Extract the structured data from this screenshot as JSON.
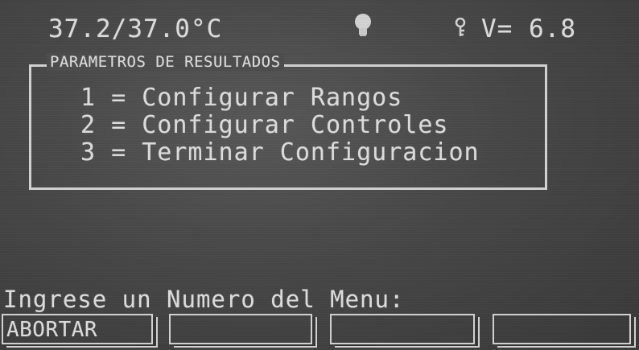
{
  "status_bar": {
    "temperature": "37.2/37.0°C",
    "bulb_icon": "lamp-icon",
    "key_icon": "key-icon",
    "voltage": "V= 6.8"
  },
  "menu": {
    "title": "PARAMETROS DE RESULTADOS",
    "items": [
      "1 = Configurar Rangos",
      "2 = Configurar Controles",
      "3 = Terminar Configuracion"
    ]
  },
  "prompt": "Ingrese un Numero del Menu:",
  "softkeys": [
    "ABORTAR",
    "",
    "",
    ""
  ],
  "colors": {
    "background": "#4a4a4a",
    "foreground": "#d9d9d9"
  }
}
